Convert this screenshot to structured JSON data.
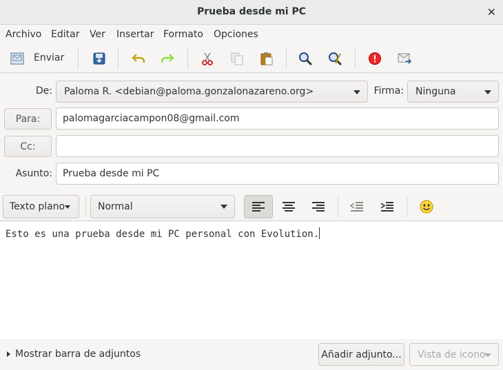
{
  "window": {
    "title": "Prueba desde mi PC",
    "close_glyph": "✕"
  },
  "menu": [
    "Archivo",
    "Editar",
    "Ver",
    "Insertar",
    "Formato",
    "Opciones"
  ],
  "toolbar": {
    "send_label": "Enviar"
  },
  "header": {
    "from_label": "De:",
    "from_value": "Paloma R. <debian@paloma.gonzalonazareno.org>",
    "signature_label": "Firma:",
    "signature_value": "Ninguna",
    "to_button": "Para:",
    "to_value": "palomagarciacampon08@gmail.com",
    "cc_button": "Cc:",
    "cc_value": "",
    "subject_label": "Asunto:",
    "subject_value": "Prueba desde mi PC"
  },
  "format": {
    "mode": "Texto plano",
    "style": "Normal"
  },
  "body": {
    "text": "Esto es una prueba desde mi PC personal con Evolution."
  },
  "attachments": {
    "show_bar_label": "Mostrar barra de adjuntos",
    "add_button": "Añadir adjunto...",
    "view_mode": "Vista de icono"
  },
  "colors": {
    "accent_blue": "#204a87",
    "undo_yellow": "#c4a000",
    "redo_green": "#73d216",
    "priority_red": "#cc0000"
  }
}
